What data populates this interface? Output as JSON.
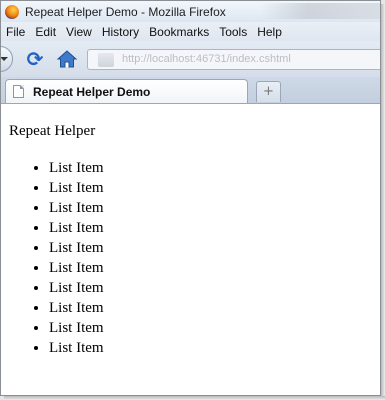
{
  "window": {
    "title": "Repeat Helper Demo - Mozilla Firefox"
  },
  "menu": {
    "items": [
      "File",
      "Edit",
      "View",
      "History",
      "Bookmarks",
      "Tools",
      "Help"
    ]
  },
  "navigation": {
    "reload_icon": "reload-icon",
    "home_icon": "home-icon",
    "url": "http://localhost:46731/index.cshtml"
  },
  "tab": {
    "title": "Repeat Helper Demo",
    "new_tab_symbol": "+"
  },
  "page": {
    "heading": "Repeat Helper",
    "items": [
      "List Item",
      "List Item",
      "List Item",
      "List Item",
      "List Item",
      "List Item",
      "List Item",
      "List Item",
      "List Item",
      "List Item"
    ]
  },
  "colors": {
    "accent": "#1f63c8",
    "chrome": "#dfe7f2"
  }
}
